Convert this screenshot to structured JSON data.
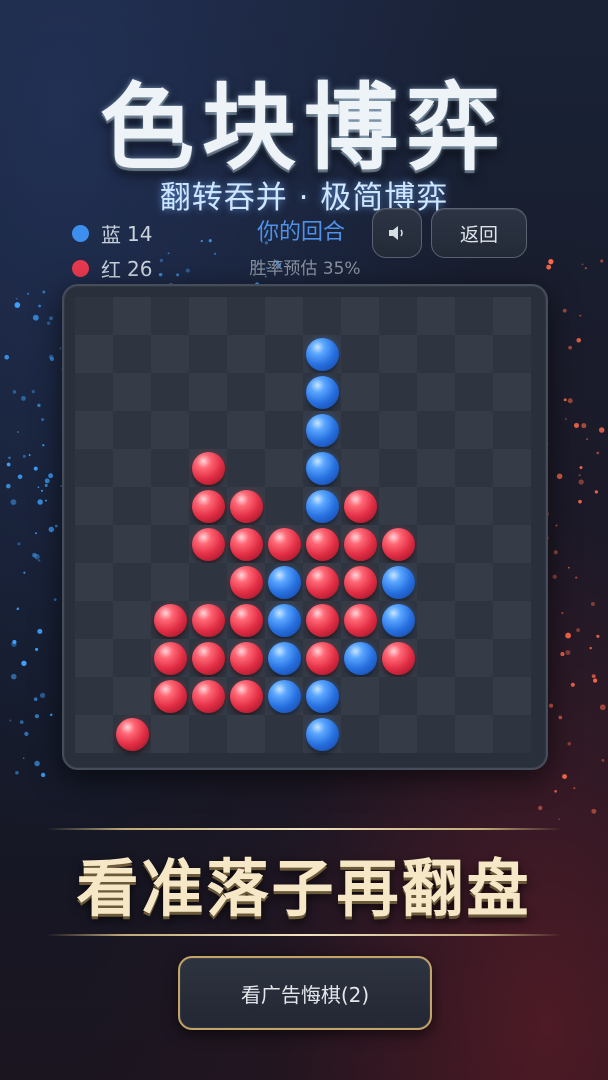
{
  "title": "色块博弈",
  "subtitle": "翻转吞并 · 极简博弈",
  "scoreboard": {
    "blue": {
      "label": "蓝",
      "count": "14",
      "color": "#3d8fee"
    },
    "red": {
      "label": "红",
      "count": "26",
      "color": "#e8394f"
    }
  },
  "turn_text": "你的回合",
  "win_rate_text": "胜率预估 35%",
  "buttons": {
    "sound_icon": "speaker-icon",
    "back_label": "返回",
    "undo_label": "看广告悔棋(2)"
  },
  "slogan": "看准落子再翻盘",
  "board": {
    "size": 12,
    "rows": [
      "............",
      "......B.....",
      "......B.....",
      "......B.....",
      "...R..B.....",
      "...RR.BR....",
      "...RRRRRR...",
      "....RBRRB...",
      "..RRRBRRB...",
      "..RRRBRBR...",
      "..RRRBB.....",
      ".R....B....."
    ]
  },
  "colors": {
    "accent_blue": "#4d92e8",
    "gold": "#c2a369"
  }
}
